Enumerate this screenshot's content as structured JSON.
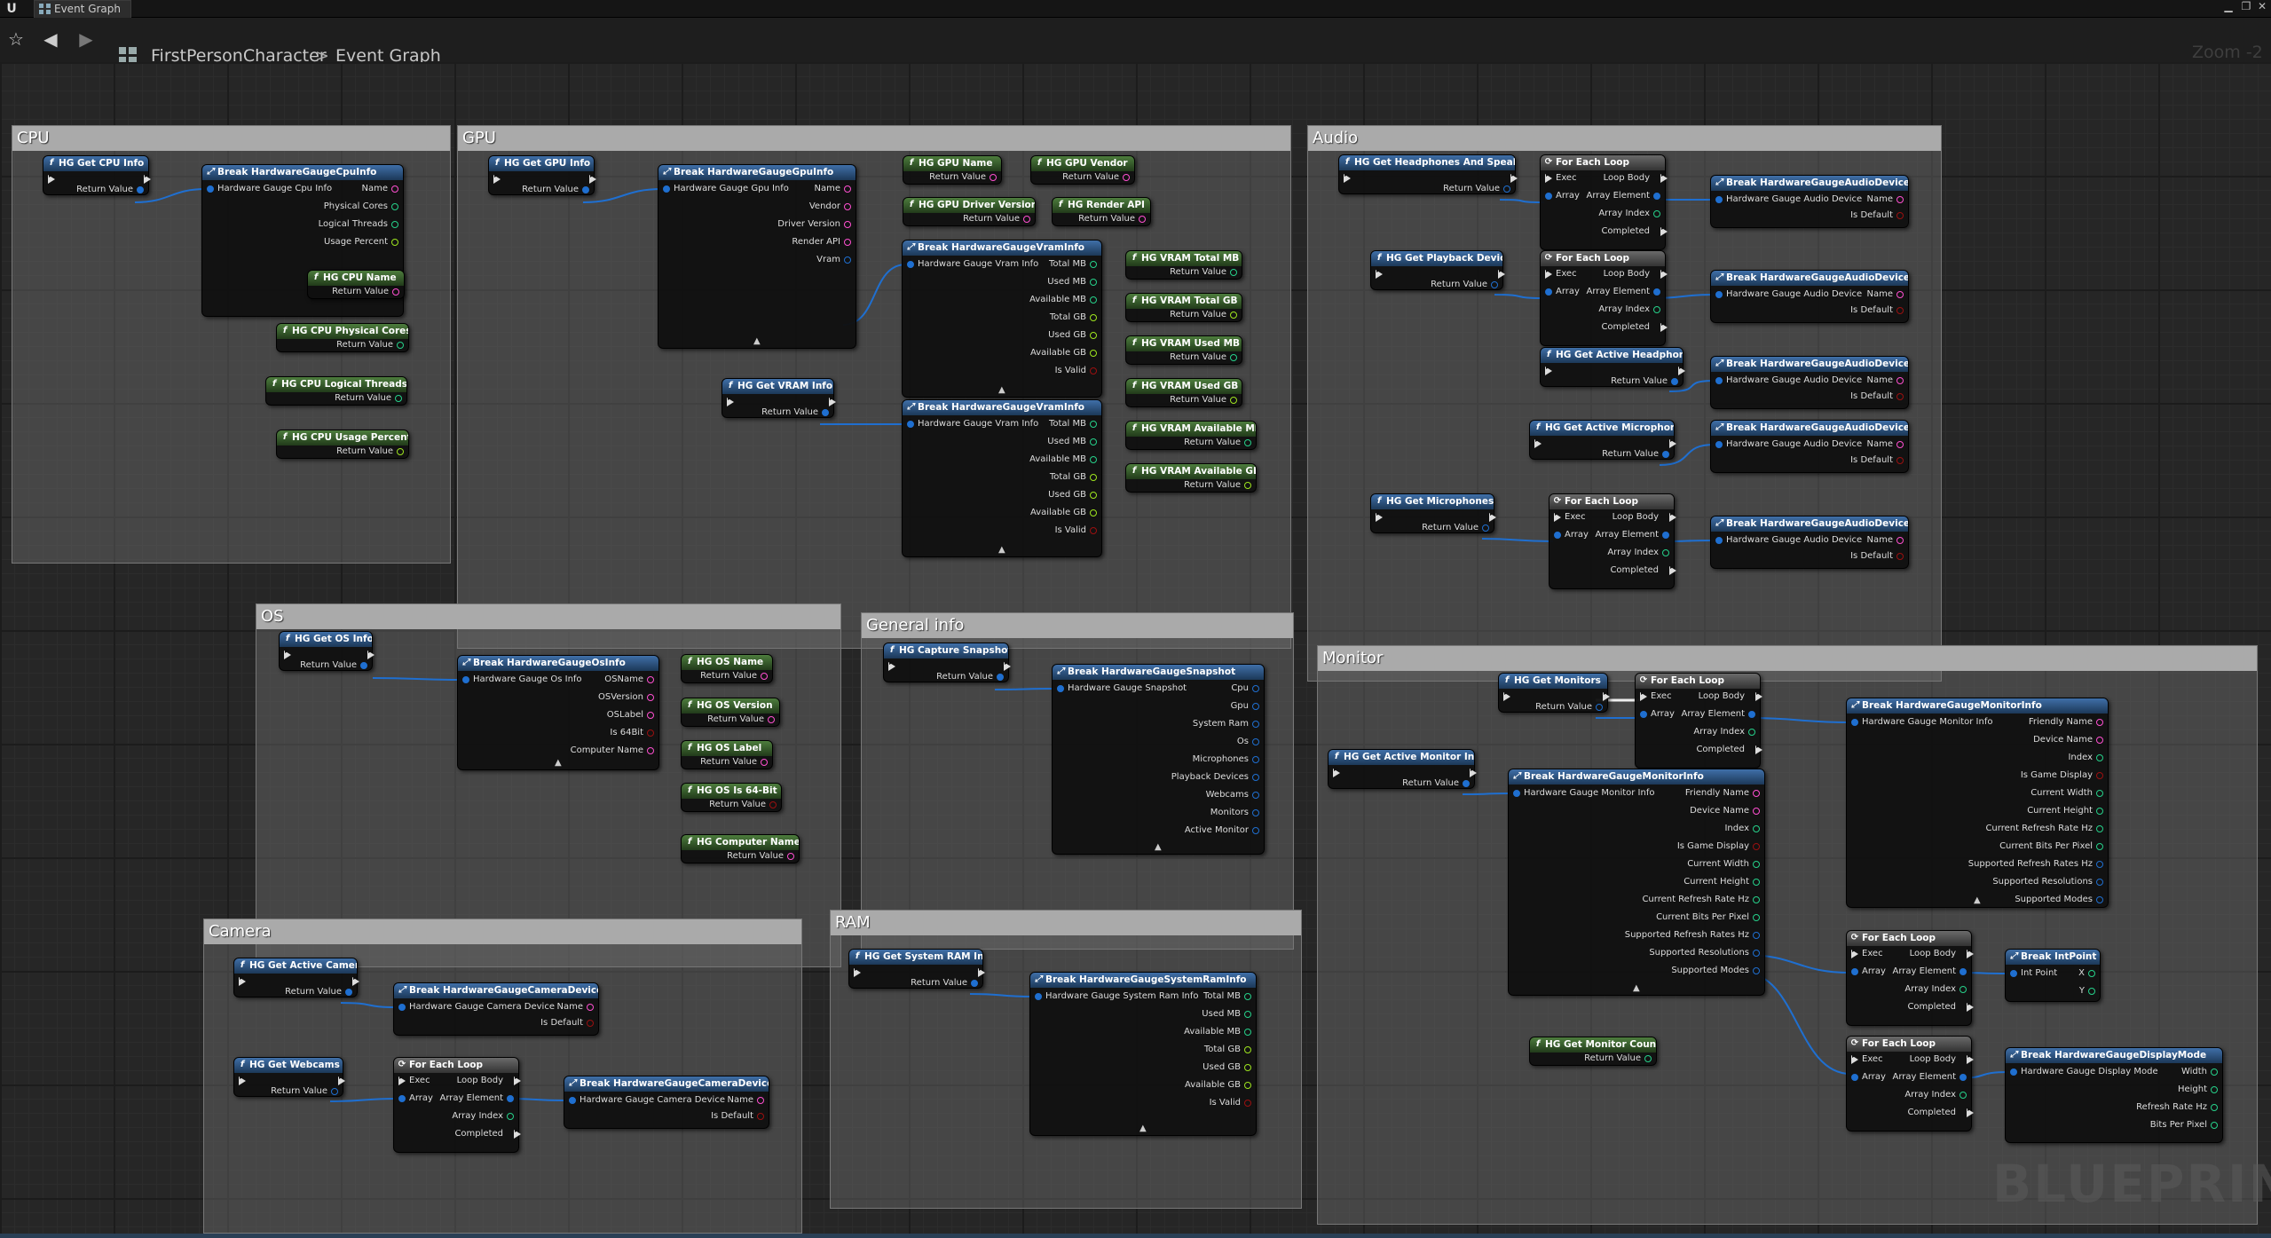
{
  "title": "Event Graph",
  "breadcrumb": [
    "FirstPersonCharacter",
    "Event Graph"
  ],
  "zoom": "Zoom -2",
  "watermark": "BLUEPRINT",
  "comments": {
    "cpu": "CPU",
    "gpu": "GPU",
    "audio": "Audio",
    "os": "OS",
    "general": "General info",
    "monitor": "Monitor",
    "camera": "Camera",
    "ram": "RAM"
  },
  "labels": {
    "return_value": "Return Value",
    "exec": "Exec",
    "array": "Array",
    "loop_body": "Loop Body",
    "array_element": "Array Element",
    "array_index": "Array Index",
    "completed": "Completed",
    "for_each_loop": "For Each Loop",
    "name": "Name",
    "is_default": "Is Default",
    "break_audio": "Break HardwareGaugeAudioDevice",
    "audio_pin": "Hardware Gauge Audio Device",
    "break_camera": "Break HardwareGaugeCameraDevice",
    "camera_pin": "Hardware Gauge Camera Device",
    "break_vram": "Break HardwareGaugeVramInfo",
    "vram_pin": "Hardware Gauge Vram Info",
    "break_monitor": "Break HardwareGaugeMonitorInfo",
    "monitor_pin": "Hardware Gauge Monitor Info"
  },
  "nodes": {
    "cpu_get": "HG Get CPU Info",
    "cpu_break": "Break HardwareGaugeCpuInfo",
    "cpu_break_in": "Hardware Gauge Cpu Info",
    "cpu_outs": [
      "Name",
      "Physical Cores",
      "Logical Threads",
      "Usage Percent"
    ],
    "cpu_name": "HG CPU Name",
    "cpu_phys": "HG CPU Physical Cores",
    "cpu_log": "HG CPU Logical Threads",
    "cpu_usage": "HG CPU Usage Percent",
    "gpu_get": "HG Get GPU Info",
    "gpu_break": "Break HardwareGaugeGpuInfo",
    "gpu_break_in": "Hardware Gauge Gpu Info",
    "gpu_outs": [
      "Name",
      "Vendor",
      "Driver Version",
      "Render API",
      "Vram"
    ],
    "gpu_name": "HG GPU Name",
    "gpu_vendor": "HG GPU Vendor",
    "gpu_driver": "HG GPU Driver Version",
    "gpu_render": "HG Render API",
    "vram_outs": [
      "Total MB",
      "Used MB",
      "Available MB",
      "Total GB",
      "Used GB",
      "Available GB",
      "Is Valid"
    ],
    "gpu_vraminfo": "HG Get VRAM Info",
    "vram_total_mb": "HG VRAM Total MB",
    "vram_total_gb": "HG VRAM Total GB",
    "vram_used_mb": "HG VRAM Used MB",
    "vram_used_gb": "HG VRAM Used GB",
    "vram_avail_mb": "HG VRAM Available MB",
    "vram_avail_gb": "HG VRAM Available GB",
    "aud_hp": "HG Get Headphones And Speakers",
    "aud_pb": "HG Get Playback Devices",
    "aud_ahp": "HG Get Active Headphones",
    "aud_amic": "HG Get Active Microphone",
    "aud_mics": "HG Get Microphones",
    "os_get": "HG Get OS Info",
    "os_break": "Break HardwareGaugeOsInfo",
    "os_break_in": "Hardware Gauge Os Info",
    "os_outs": [
      "OSName",
      "OSVersion",
      "OSLabel",
      "Is 64Bit",
      "Computer Name"
    ],
    "os_name": "HG OS Name",
    "os_version": "HG OS Version",
    "os_label": "HG OS Label",
    "os_64": "HG OS Is 64-Bit",
    "os_comp": "HG Computer Name",
    "gen_snap": "HG Capture Snapshot",
    "gen_break": "Break HardwareGaugeSnapshot",
    "gen_break_in": "Hardware Gauge Snapshot",
    "gen_outs": [
      "Cpu",
      "Gpu",
      "System Ram",
      "Os",
      "Microphones",
      "Playback Devices",
      "Webcams",
      "Monitors",
      "Active Monitor"
    ],
    "mon_get": "HG Get Monitors",
    "mon_active": "HG Get Active Monitor Info",
    "mon_outs": [
      "Friendly Name",
      "Device Name",
      "Index",
      "Is Game Display",
      "Current Width",
      "Current Height",
      "Current Refresh Rate Hz",
      "Current Bits Per Pixel",
      "Supported Refresh Rates Hz",
      "Supported Resolutions",
      "Supported Modes"
    ],
    "mon_count": "HG Get Monitor Count",
    "break_intpoint": "Break IntPoint",
    "intpoint_in": "Int Point",
    "intpoint_outs": [
      "X",
      "Y"
    ],
    "break_mode": "Break HardwareGaugeDisplayMode",
    "mode_in": "Hardware Gauge Display Mode",
    "mode_outs": [
      "Width",
      "Height",
      "Refresh Rate Hz",
      "Bits Per Pixel"
    ],
    "cam_active": "HG Get Active Camera",
    "cam_webcams": "HG Get Webcams",
    "ram_get": "HG Get System RAM Info",
    "ram_break": "Break HardwareGaugeSystemRamInfo",
    "ram_break_in": "Hardware Gauge System Ram Info",
    "ram_outs": [
      "Total MB",
      "Used MB",
      "Available MB",
      "Total GB",
      "Used GB",
      "Available GB",
      "Is Valid"
    ]
  },
  "colors": {
    "struct": "#1f6fd0",
    "string": "#ff4fd1",
    "int": "#26d18a",
    "bool": "#9b1010",
    "float": "#9ee51f",
    "exec": "#dddddd"
  }
}
